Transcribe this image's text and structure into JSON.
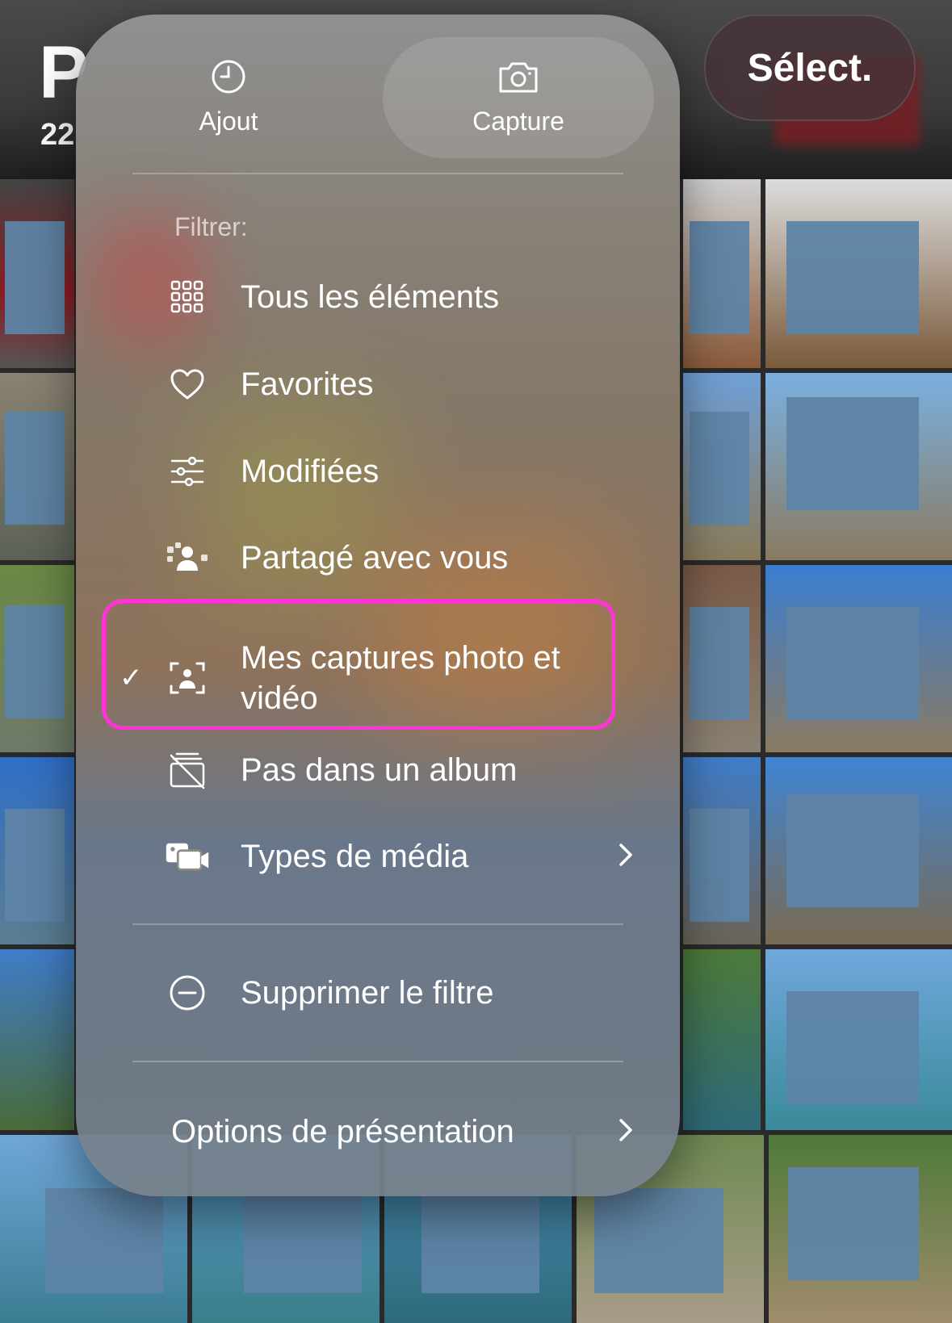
{
  "header": {
    "title": "P",
    "count": "22",
    "select_label": "Sélect."
  },
  "menu": {
    "top_actions": [
      {
        "label": "Ajout",
        "icon": "clock-icon"
      },
      {
        "label": "Capture",
        "icon": "camera-icon"
      }
    ],
    "filter_label": "Filtrer:",
    "items": [
      {
        "label": "Tous les éléments",
        "icon": "grid-icon"
      },
      {
        "label": "Favorites",
        "icon": "heart-icon"
      },
      {
        "label": "Modifiées",
        "icon": "sliders-icon"
      },
      {
        "label": "Partagé avec vous",
        "icon": "shared-people-icon"
      },
      {
        "label": "Mes captures photo et vidéo",
        "icon": "person-viewfinder-icon",
        "checked": true
      },
      {
        "label": "Pas dans un album",
        "icon": "no-album-icon"
      },
      {
        "label": "Types de média",
        "icon": "media-types-icon",
        "has_submenu": true
      }
    ],
    "remove_filter": {
      "label": "Supprimer le filtre",
      "icon": "minus-circle-icon"
    },
    "view_options": {
      "label": "Options de présentation",
      "has_submenu": true
    }
  },
  "colors": {
    "highlight": "#ff33d6",
    "redaction": "#5e84a6"
  }
}
